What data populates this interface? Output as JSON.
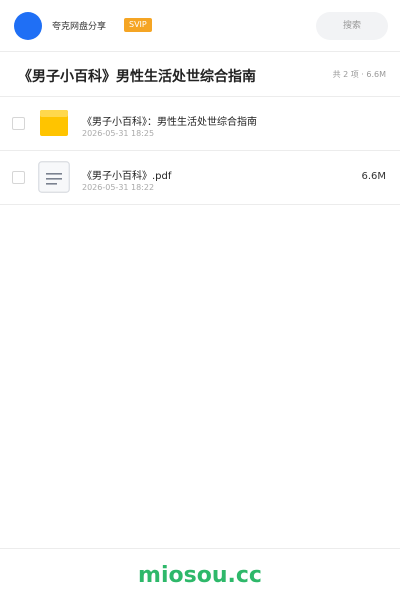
{
  "header": {
    "brand": "夸克网盘分享",
    "badge": "SVIP",
    "search_placeholder": "搜索"
  },
  "folder": {
    "title": "《男子小百科》男性生活处世综合指南",
    "summary": "共 2 项 · 6.6M"
  },
  "files": [
    {
      "name": "《男子小百科》：男性生活处世综合指南",
      "date": "2026-05-31 18:25",
      "size": "",
      "type": "folder-icon"
    },
    {
      "name": "《男子小百科》.pdf",
      "date": "2026-05-31 18:22",
      "size": "6.6M",
      "type": "document-icon"
    }
  ],
  "footer": {
    "watermark": "miosou.cc"
  },
  "colors": {
    "accent": "#1f6ff5",
    "badge": "#f5a524",
    "watermark": "#2eb86a"
  }
}
